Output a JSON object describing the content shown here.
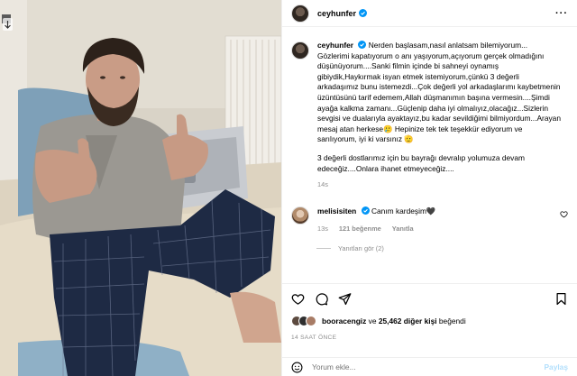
{
  "post": {
    "username": "ceyhunfer",
    "more_icon": "more-horizontal-icon",
    "caption": {
      "username": "ceyhunfer",
      "text": "Nerden başlasam,nasıl anlatsam bilemiyorum... Gözlerimi kapatıyorum o anı yaşıyorum,açıyorum gerçek olmadığını düşünüyorum....Sanki filmin içinde bi sahneyi oynamış gibiydik,Haykırmak isyan etmek istemiyorum,çünkü 3 değerli arkadaşımız bunu istemezdi...Çok değerli yol arkadaşlarımı kaybetmenin üzüntüsünü tarif edemem,Allah düşmanımın başına vermesin....Şimdi ayağa kalkma zamanı...Güçlenip daha iyi olmalıyız,olacağız...Sizlerin sevgisi ve dualarıyla ayaktayız,bu kadar sevildiğimi bilmiyordum...Arayan mesaj atan herkese🥲 Hepinize tek tek teşekkür ediyorum ve sarılıyorum, iyi ki varsınız 🫡",
      "text2": "3 değerli dostlarımız için bu bayrağı devralıp yolumuza devam edeceğiz....Onlara ihanet etmeyeceğiz....",
      "age": "14s"
    },
    "comment": {
      "username": "melisisiten",
      "text": "Canım kardeşim🖤",
      "age": "13s",
      "likes": "121 beğenme",
      "reply": "Yanıtla",
      "view_replies": "Yanıtları gör (2)"
    },
    "likes": {
      "first_user": "booracengiz",
      "connector": "ve",
      "count": "25,462 diğer kişi",
      "suffix": "beğendi"
    },
    "timestamp": "14 SAAT ÖNCE",
    "add_comment": {
      "placeholder": "Yorum ekle...",
      "post_label": "Paylaş"
    }
  },
  "colors": {
    "verified": "#0095f6",
    "muted": "#8e8e8e",
    "post_disabled": "#b2dffc"
  }
}
